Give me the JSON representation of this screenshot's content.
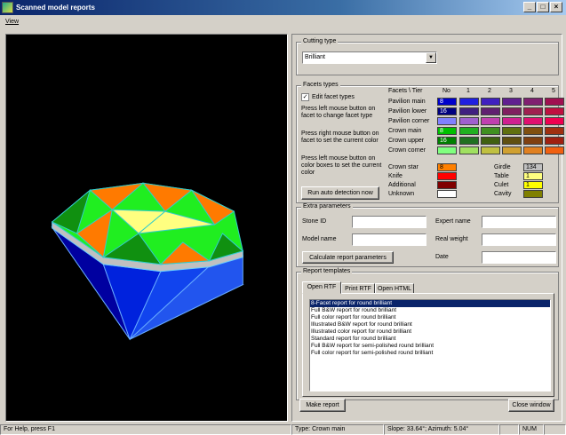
{
  "window": {
    "title": "Scanned model reports",
    "min": "_",
    "max": "□",
    "close": "×"
  },
  "menu": {
    "view": "View"
  },
  "cutting": {
    "legend": "Cutting type",
    "value": "Brilliant"
  },
  "facets": {
    "legend": "Facets types",
    "edit_label": "Edit facet types",
    "edit_checked": true,
    "help1": "Press left mouse button on facet to change facet type",
    "help2": "Press right mouse button on facet to set the current color",
    "help3": "Press left mouse button on color boxes to set the current color",
    "auto_button": "Run auto detection now",
    "header": "Facets \\ Tier",
    "cols": [
      "No",
      "1",
      "2",
      "3",
      "4",
      "5"
    ],
    "rows": [
      {
        "name": "Pavilion main",
        "no": "8",
        "colors": [
          "#0000cc",
          "#2020e0",
          "#4020c0",
          "#602090",
          "#802070",
          "#a01050"
        ]
      },
      {
        "name": "Pavilion lower",
        "no": "16",
        "colors": [
          "#000080",
          "#402080",
          "#602070",
          "#802060",
          "#a02050",
          "#c01040"
        ]
      },
      {
        "name": "Pavilion corner",
        "no": "",
        "colors": [
          "#8080ff",
          "#a060d0",
          "#c040b0",
          "#d02090",
          "#e01070",
          "#f00050"
        ]
      },
      {
        "name": "Crown main",
        "no": "8",
        "colors": [
          "#00c000",
          "#20b020",
          "#409020",
          "#607010",
          "#805010",
          "#a03010"
        ]
      },
      {
        "name": "Crown upper",
        "no": "16",
        "colors": [
          "#008000",
          "#207020",
          "#406010",
          "#605010",
          "#804010",
          "#a02010"
        ]
      },
      {
        "name": "Crown corner",
        "no": "",
        "colors": [
          "#80ff80",
          "#a0e060",
          "#c0c040",
          "#d0a030",
          "#e08020",
          "#f06010"
        ]
      }
    ],
    "extra_left": [
      {
        "name": "Crown star",
        "value": "8",
        "color": "#ff8000"
      },
      {
        "name": "Knife",
        "value": "",
        "color": "#ff0000"
      },
      {
        "name": "Additional",
        "value": "",
        "color": "#800000"
      },
      {
        "name": "Unknown",
        "value": "",
        "color": "#ffffff"
      }
    ],
    "extra_right": [
      {
        "name": "Girdle",
        "value": "134",
        "color": "#c0c0c0"
      },
      {
        "name": "Table",
        "value": "1",
        "color": "#ffff80"
      },
      {
        "name": "Culet",
        "value": "1",
        "color": "#ffff00"
      },
      {
        "name": "Cavity",
        "value": "",
        "color": "#808000"
      }
    ]
  },
  "extra": {
    "legend": "Extra parameters",
    "stone_id": "Stone ID",
    "model_name": "Model name",
    "expert_name": "Expert name",
    "real_weight": "Real weight",
    "date": "Date",
    "calc_button": "Calculate report parameters"
  },
  "templates": {
    "legend": "Report templates",
    "tabs": [
      "Open RTF",
      "Print RTF",
      "Open HTML"
    ],
    "items": [
      "8-Facet report for round brilliant",
      "Full B&W report for round brilliant",
      "Full color report for round brilliant",
      "Illustrated B&W report for round brilliant",
      "Illustrated color report for round brilliant",
      "Standard report for round brilliant",
      "Full B&W report for semi-polished round brilliant",
      "Full color report for semi-polished round brilliant"
    ],
    "selected_index": 0
  },
  "buttons": {
    "make_report": "Make report",
    "close_window": "Close window"
  },
  "status": {
    "help": "For Help, press F1",
    "type": "Type: Crown main",
    "angles": "Slope:  33.64°; Azimuth:   5.04°",
    "num": "NUM"
  }
}
